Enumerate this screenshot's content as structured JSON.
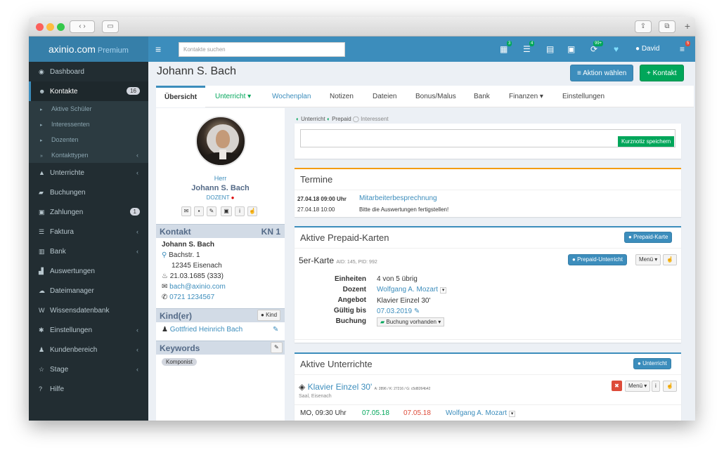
{
  "brand": {
    "name": "axinio.com",
    "tier": "Premium"
  },
  "search": {
    "placeholder": "Kontakte suchen"
  },
  "topbar": {
    "user": "David",
    "badges": {
      "calendar": "3",
      "tasks": "4",
      "sync": "99+",
      "menu": "5"
    }
  },
  "sidebar": {
    "items": [
      {
        "label": "Dashboard"
      },
      {
        "label": "Kontakte",
        "count": "16"
      },
      {
        "label": "Unterrichte"
      },
      {
        "label": "Buchungen"
      },
      {
        "label": "Zahlungen",
        "count": "1"
      },
      {
        "label": "Faktura"
      },
      {
        "label": "Bank"
      },
      {
        "label": "Auswertungen"
      },
      {
        "label": "Dateimanager"
      },
      {
        "label": "Wissensdatenbank"
      },
      {
        "label": "Einstellungen"
      },
      {
        "label": "Kundenbereich"
      },
      {
        "label": "Stage"
      },
      {
        "label": "Hilfe"
      }
    ],
    "sub": [
      "Aktive Schüler",
      "Interessenten",
      "Dozenten",
      "Kontakttypen"
    ]
  },
  "page": {
    "title": "Johann S. Bach",
    "action_button": "Aktion wählen",
    "contact_button": "Kontakt"
  },
  "tabs": [
    "Übersicht",
    "Unterricht",
    "Wochenplan",
    "Notizen",
    "Dateien",
    "Bonus/Malus",
    "Bank",
    "Finanzen",
    "Einstellungen"
  ],
  "profile": {
    "salutation": "Herr",
    "name": "Johann S. Bach",
    "role": "DOZENT",
    "contact_title": "Kontakt",
    "kn": "KN 1",
    "address_name": "Johann S. Bach",
    "street": "Bachstr. 1",
    "city": "12345 Eisenach",
    "birth": "21.03.1685 (333)",
    "email": "bach@axinio.com",
    "phone": "0721 1234567",
    "kind_title": "Kind(er)",
    "kind_button": "Kind",
    "child": "Gottfried Heinrich Bach",
    "keywords_title": "Keywords",
    "keyword": "Komponist"
  },
  "status": {
    "unterricht": "Unterricht",
    "prepaid": "Prepaid",
    "interessent": "Interessent"
  },
  "note": {
    "save": "Kurznotiz speichern"
  },
  "termine": {
    "title": "Termine",
    "date": "27.04.18 09:00 Uhr",
    "subject": "Mitarbeiterbesprechnung",
    "date2": "27.04.18 10:00",
    "text": "Bitte die Auswertungen fertigstellen!"
  },
  "prepaid": {
    "title": "Aktive Prepaid-Karten",
    "add_button": "Prepaid-Karte",
    "card_name": "5er-Karte",
    "card_ids": "AID: 145, PID: 992",
    "pu_button": "Prepaid-Unterricht",
    "menu": "Menü",
    "rows": [
      {
        "label": "Einheiten",
        "value": "4 von 5 übrig"
      },
      {
        "label": "Dozent",
        "value": "Wolfgang A. Mozart"
      },
      {
        "label": "Angebot",
        "value": "Klavier Einzel 30'"
      },
      {
        "label": "Gültig bis",
        "value": "07.03.2019"
      },
      {
        "label": "Buchung",
        "value": "Buchung vorhanden"
      }
    ]
  },
  "unterrichte": {
    "title": "Aktive Unterrichte",
    "add_button": "Unterricht",
    "course": "Klavier Einzel 30'",
    "ids": "A: 2896 / K: 27216 / G: c5d8264b42",
    "location": "Saal, Eisenach",
    "menu": "Menü",
    "day": "MO, 09:30 Uhr",
    "start": "07.05.18",
    "end": "07.05.18",
    "teacher": "Wolfgang A. Mozart"
  }
}
